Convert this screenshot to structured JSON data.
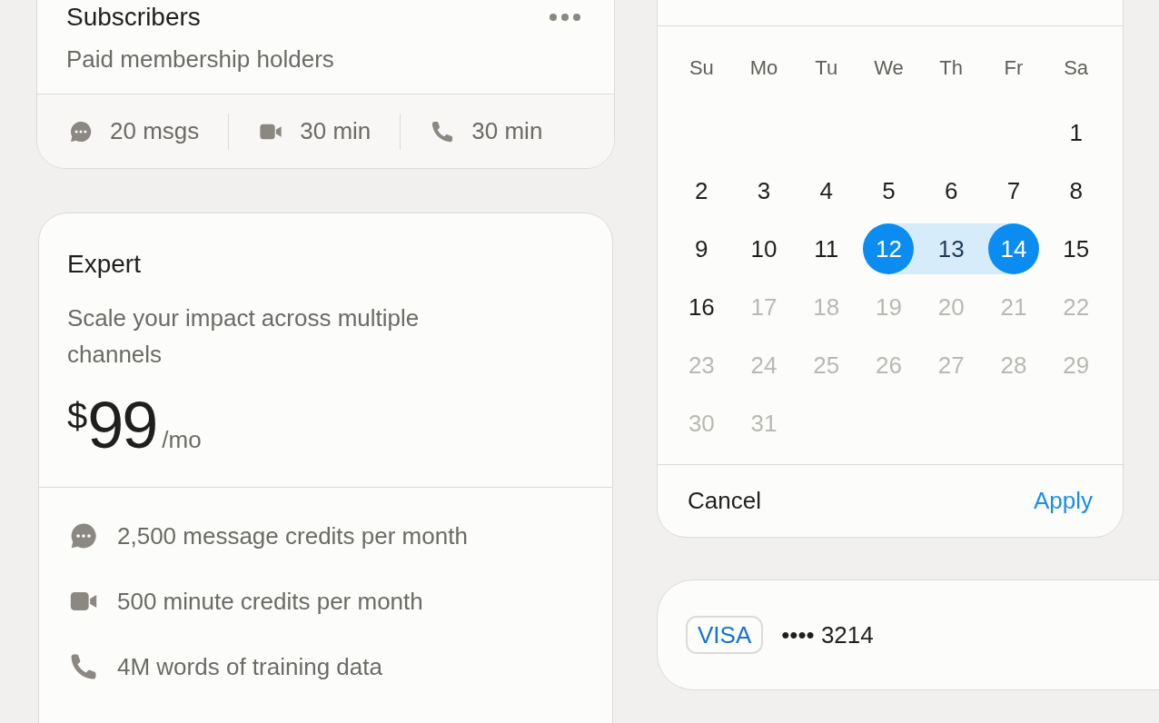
{
  "subscribers_card": {
    "title": "Subscribers",
    "subtitle": "Paid membership holders",
    "stats": [
      {
        "kind": "messages",
        "text": "20 msgs"
      },
      {
        "kind": "video",
        "text": "30 min"
      },
      {
        "kind": "call",
        "text": "30 min"
      }
    ]
  },
  "expert_card": {
    "title": "Expert",
    "description": "Scale your impact across multiple channels",
    "currency": "$",
    "price": "99",
    "period": "/mo",
    "features": [
      {
        "kind": "messages",
        "text": "2,500 message credits per month"
      },
      {
        "kind": "video",
        "text": "500 minute credits per month"
      },
      {
        "kind": "call",
        "text": "4M words of training data"
      }
    ]
  },
  "calendar": {
    "weekdays": [
      "Su",
      "Mo",
      "Tu",
      "We",
      "Th",
      "Fr",
      "Sa"
    ],
    "weeks": [
      {
        "days": [
          {
            "kind": "empty"
          },
          {
            "kind": "empty"
          },
          {
            "kind": "empty"
          },
          {
            "kind": "empty"
          },
          {
            "kind": "empty"
          },
          {
            "kind": "empty"
          },
          {
            "kind": "day",
            "label": "1",
            "selected": false,
            "in_range": false,
            "disabled": false
          }
        ]
      },
      {
        "days": [
          {
            "label": "2",
            "selected": false,
            "in_range": false,
            "disabled": false
          },
          {
            "label": "3",
            "selected": false,
            "in_range": false,
            "disabled": false
          },
          {
            "label": "4",
            "selected": false,
            "in_range": false,
            "disabled": false
          },
          {
            "label": "5",
            "selected": false,
            "in_range": false,
            "disabled": false
          },
          {
            "label": "6",
            "selected": false,
            "in_range": false,
            "disabled": false
          },
          {
            "label": "7",
            "selected": false,
            "in_range": false,
            "disabled": false
          },
          {
            "label": "8",
            "selected": false,
            "in_range": false,
            "disabled": false
          }
        ]
      },
      {
        "days": [
          {
            "label": "9",
            "selected": false,
            "in_range": false,
            "disabled": false
          },
          {
            "label": "10",
            "selected": false,
            "in_range": false,
            "disabled": false
          },
          {
            "label": "11",
            "selected": false,
            "in_range": false,
            "disabled": false
          },
          {
            "label": "12",
            "selected": true,
            "in_range": false,
            "disabled": false
          },
          {
            "label": "13",
            "selected": false,
            "in_range": true,
            "disabled": false
          },
          {
            "label": "14",
            "selected": true,
            "in_range": false,
            "disabled": false
          },
          {
            "label": "15",
            "selected": false,
            "in_range": false,
            "disabled": false
          }
        ]
      },
      {
        "days": [
          {
            "label": "16",
            "selected": false,
            "in_range": false,
            "disabled": false
          },
          {
            "label": "17",
            "selected": false,
            "in_range": false,
            "disabled": true
          },
          {
            "label": "18",
            "selected": false,
            "in_range": false,
            "disabled": true
          },
          {
            "label": "19",
            "selected": false,
            "in_range": false,
            "disabled": true
          },
          {
            "label": "20",
            "selected": false,
            "in_range": false,
            "disabled": true
          },
          {
            "label": "21",
            "selected": false,
            "in_range": false,
            "disabled": true
          },
          {
            "label": "22",
            "selected": false,
            "in_range": false,
            "disabled": true
          }
        ]
      },
      {
        "days": [
          {
            "label": "23",
            "selected": false,
            "in_range": false,
            "disabled": true
          },
          {
            "label": "24",
            "selected": false,
            "in_range": false,
            "disabled": true
          },
          {
            "label": "25",
            "selected": false,
            "in_range": false,
            "disabled": true
          },
          {
            "label": "26",
            "selected": false,
            "in_range": false,
            "disabled": true
          },
          {
            "label": "27",
            "selected": false,
            "in_range": false,
            "disabled": true
          },
          {
            "label": "28",
            "selected": false,
            "in_range": false,
            "disabled": true
          },
          {
            "label": "29",
            "selected": false,
            "in_range": false,
            "disabled": true
          }
        ]
      },
      {
        "days": [
          {
            "label": "30",
            "selected": false,
            "in_range": false,
            "disabled": true
          },
          {
            "label": "31",
            "selected": false,
            "in_range": false,
            "disabled": true
          }
        ]
      }
    ],
    "cancel": "Cancel",
    "apply": "Apply"
  },
  "payment_card": {
    "brand": "VISA",
    "masked_number": "•••• 3214"
  }
}
